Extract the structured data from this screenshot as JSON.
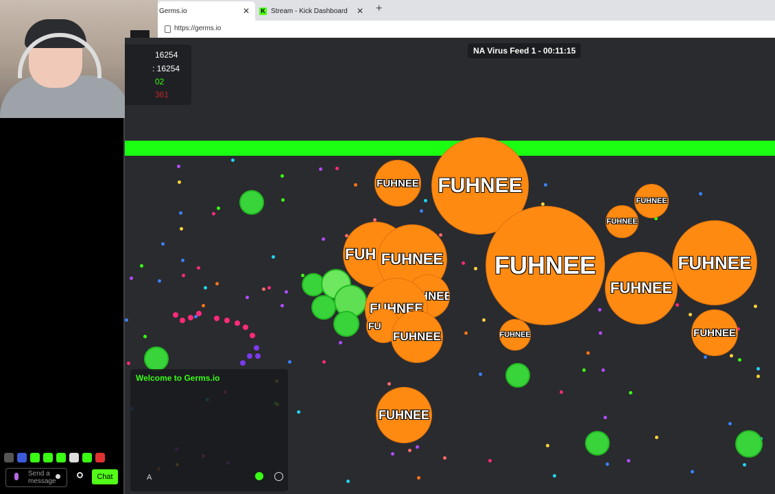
{
  "browser": {
    "tabs": [
      {
        "label": "Germs.io",
        "active": true
      },
      {
        "label": "Stream - Kick Dashboard",
        "active": false
      }
    ],
    "url": "https://germs.io"
  },
  "game": {
    "server_label": "NA Virus Feed 1 - 00:11:15",
    "stats": [
      {
        "text": "16254",
        "color": "#ffffff"
      },
      {
        "text": ": 16254",
        "color": "#ffffff"
      },
      {
        "text": "02",
        "color": "#39ff14"
      },
      {
        "text": "361",
        "color": "#ff2a2a"
      }
    ],
    "player_name": "FUHNEE",
    "partial_names": [
      "FUH",
      "FU"
    ],
    "chat": {
      "welcome": "Welcome to Germs.io",
      "input_prefix": "A"
    }
  },
  "kick_panel": {
    "send_placeholder": "Send a message",
    "chat_button": "Chat"
  },
  "colors": {
    "player": "#ff8a12",
    "virus": "#38d43a",
    "border": "#1aff12",
    "kick_green": "#53fc18"
  }
}
